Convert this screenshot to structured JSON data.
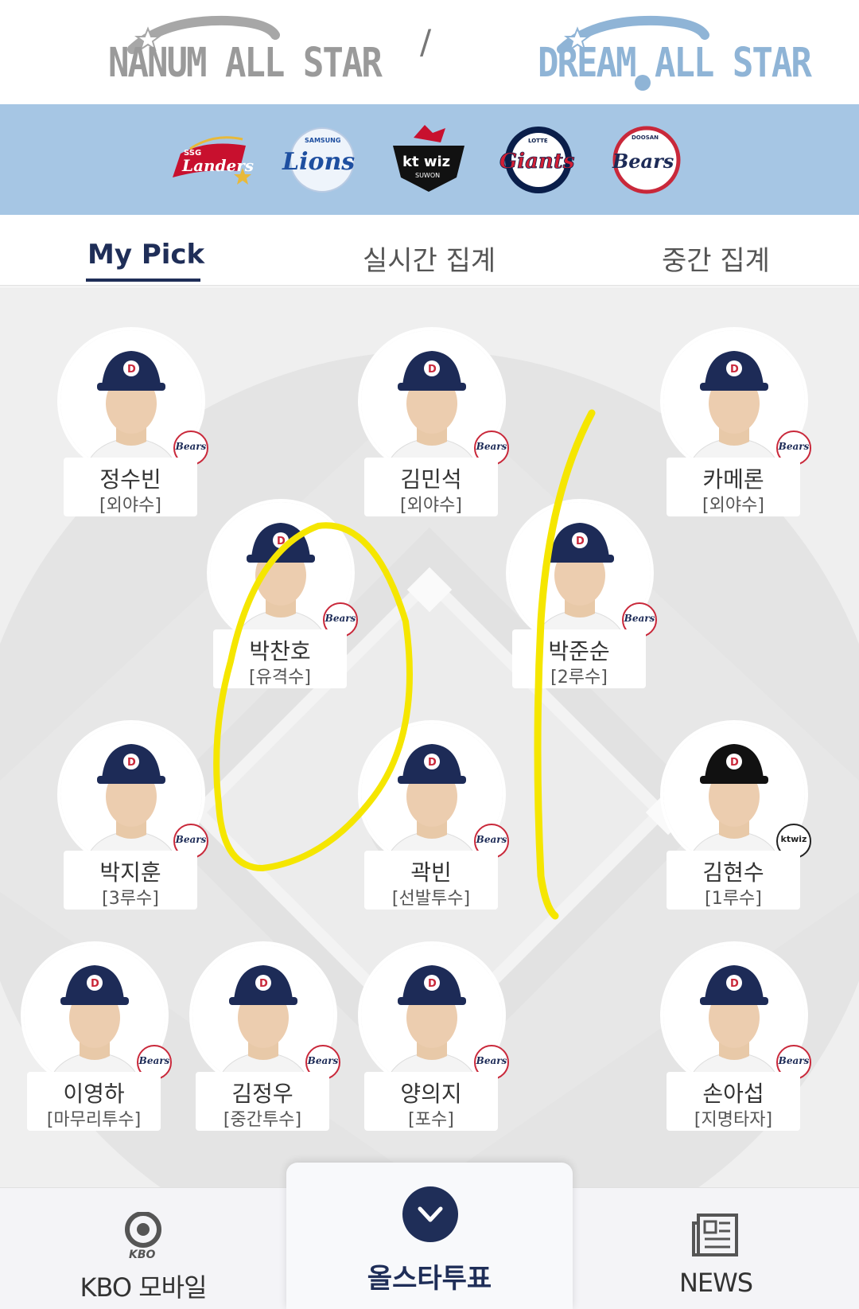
{
  "header": {
    "nanum_logo_text": "NANUM ALL STAR",
    "dream_logo_text": "DREAM ALL STAR",
    "separator": "/"
  },
  "teams": [
    {
      "name": "SSG Landers",
      "logo_text": "Landers",
      "small_text": "SSG",
      "icon": "ssg-landers-logo",
      "color": "#c8102e"
    },
    {
      "name": "Samsung Lions",
      "logo_text": "Lions",
      "small_text": "SAMSUNG",
      "icon": "samsung-lions-logo",
      "color": "#1e4fa0"
    },
    {
      "name": "kt wiz",
      "logo_text": "kt wiz",
      "small_text": "SUWON",
      "icon": "kt-wiz-logo",
      "color": "#111111"
    },
    {
      "name": "Lotte Giants",
      "logo_text": "Giants",
      "small_text": "LOTTE",
      "icon": "lotte-giants-logo",
      "color": "#0a1e4a"
    },
    {
      "name": "Doosan Bears",
      "logo_text": "Bears",
      "small_text": "DOOSAN",
      "icon": "doosan-bears-logo",
      "color": "#1d2b57"
    }
  ],
  "tabs": [
    {
      "label": "My Pick",
      "active": true
    },
    {
      "label": "실시간 집계",
      "active": false
    },
    {
      "label": "중간 집계",
      "active": false
    }
  ],
  "players": [
    {
      "name": "정수빈",
      "position": "[외야수]",
      "team_badge": "Bears"
    },
    {
      "name": "김민석",
      "position": "[외야수]",
      "team_badge": "Bears"
    },
    {
      "name": "카메론",
      "position": "[외야수]",
      "team_badge": "Bears"
    },
    {
      "name": "박찬호",
      "position": "[유격수]",
      "team_badge": "Bears"
    },
    {
      "name": "박준순",
      "position": "[2루수]",
      "team_badge": "Bears"
    },
    {
      "name": "박지훈",
      "position": "[3루수]",
      "team_badge": "Bears"
    },
    {
      "name": "곽빈",
      "position": "[선발투수]",
      "team_badge": "Bears"
    },
    {
      "name": "김현수",
      "position": "[1루수]",
      "team_badge": "ktwiz"
    },
    {
      "name": "이영하",
      "position": "[마무리투수]",
      "team_badge": "Bears"
    },
    {
      "name": "김정우",
      "position": "[중간투수]",
      "team_badge": "Bears"
    },
    {
      "name": "양의지",
      "position": "[포수]",
      "team_badge": "Bears"
    },
    {
      "name": "손아섭",
      "position": "[지명타자]",
      "team_badge": "Bears"
    }
  ],
  "bottom_nav": {
    "kbo": {
      "label": "KBO 모바일",
      "icon_caption": "KBO",
      "icon": "kbo-logo-icon"
    },
    "vote": {
      "label": "올스타투표",
      "icon": "chevron-down-icon"
    },
    "news": {
      "label": "NEWS",
      "icon": "newspaper-icon"
    }
  },
  "colors": {
    "navy": "#1f2e58",
    "strip_blue": "#a6c6e4",
    "dream_blue": "#8fb4d6",
    "scribble_yellow": "#f5e600"
  }
}
